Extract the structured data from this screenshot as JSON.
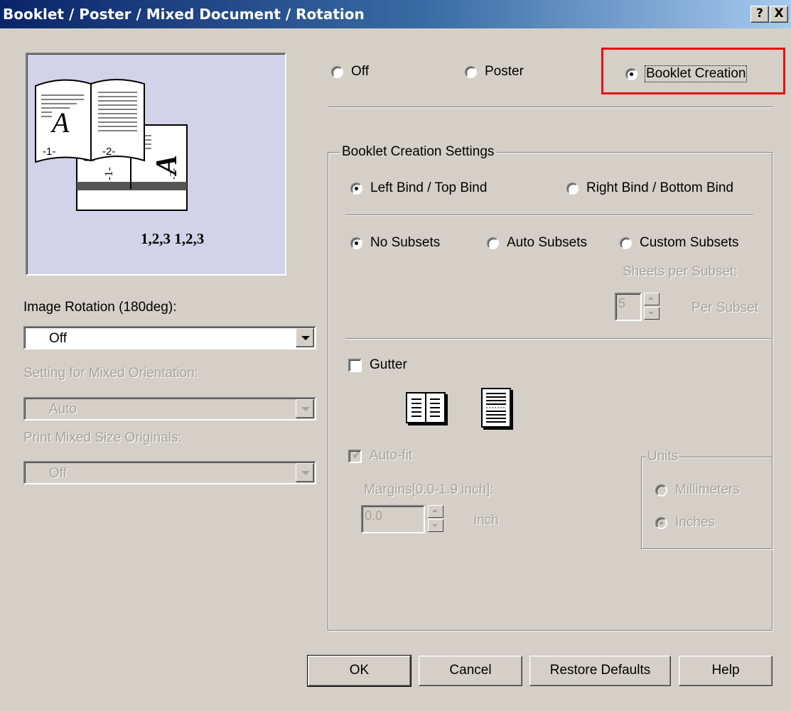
{
  "window": {
    "title": "Booklet / Poster / Mixed Document / Rotation",
    "help_btn": "?",
    "close_btn": "X"
  },
  "preview": {
    "caption": "1,2,3  1,2,3",
    "page_labels": [
      "-1-",
      "-2-",
      "-1-",
      "-2-"
    ],
    "letter": "A"
  },
  "left": {
    "rotation_label": "Image Rotation (180deg):",
    "rotation_value": "Off",
    "mixed_orient_label": "Setting for Mixed Orientation:",
    "mixed_orient_value": "Auto",
    "mixed_size_label": "Print Mixed Size Originals:",
    "mixed_size_value": "Off"
  },
  "mode": {
    "off": "Off",
    "poster": "Poster",
    "booklet": "Booklet Creation"
  },
  "booklet": {
    "group_title": "Booklet Creation Settings",
    "left_bind": "Left Bind / Top Bind",
    "right_bind": "Right Bind / Bottom Bind",
    "no_subsets": "No Subsets",
    "auto_subsets": "Auto Subsets",
    "custom_subsets": "Custom Subsets",
    "sheets_per_subset": "Sheets per Subset:",
    "subset_value": "5",
    "per_subset": "Per Subset",
    "gutter": "Gutter",
    "auto_fit": "Auto-fit",
    "margins_label": "Margins[0.0-1.9 inch]:",
    "margin_value": "0.0",
    "inch": "inch"
  },
  "units": {
    "title": "Units",
    "millimeters": "Millimeters",
    "inches": "Inches"
  },
  "buttons": {
    "ok": "OK",
    "cancel": "Cancel",
    "restore": "Restore Defaults",
    "help": "Help"
  },
  "colors": {
    "dialog_bg": "#d4d0c8",
    "title_start": "#0a246a",
    "title_end": "#a6caf0",
    "preview_bg": "#d2d2e8",
    "highlight": "#e31010"
  }
}
